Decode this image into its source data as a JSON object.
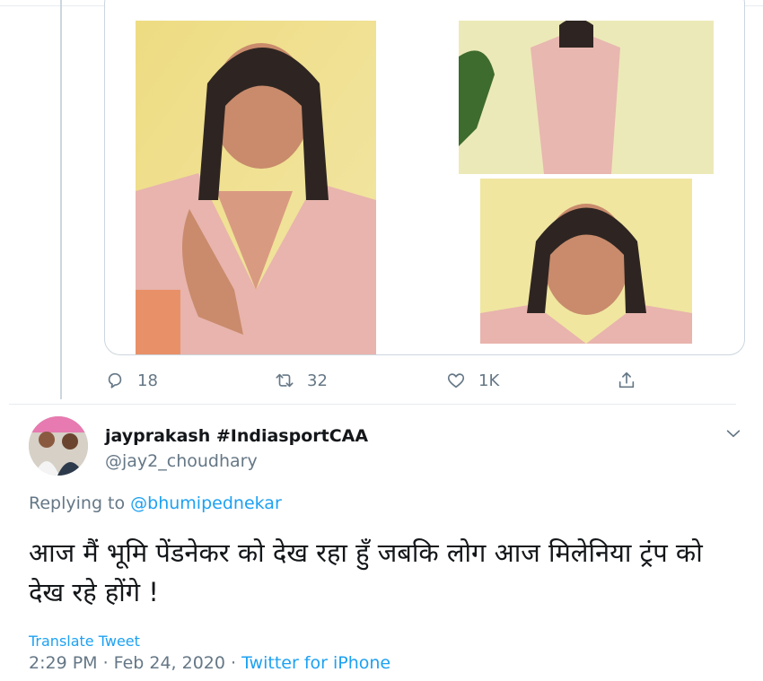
{
  "quoted_tweet": {
    "media": [
      {
        "icon": "photo-woman-pink-dress"
      },
      {
        "icon": "photo-woman-pink-gown-standing"
      },
      {
        "icon": "photo-woman-portrait"
      }
    ],
    "actions": {
      "reply_count": "18",
      "retweet_count": "32",
      "like_count": "1K"
    }
  },
  "reply": {
    "display_name": "jayprakash #IndiasportCAA",
    "handle": "@jay2_choudhary",
    "replying_prefix": "Replying to ",
    "replying_to": "@bhumipednekar",
    "text": "आज मैं भूमि पेंडनेकर को देख रहा हुँ जबकि लोग आज मिलेनिया ट्रंप को देख रहे होंगे !",
    "translate_label": "Translate Tweet",
    "timestamp": "2:29 PM · Feb 24, 2020 · ",
    "source": "Twitter for iPhone"
  },
  "colors": {
    "link": "#1da1f2",
    "muted": "#657786",
    "text": "#14171a",
    "border": "#ccd6dd"
  }
}
